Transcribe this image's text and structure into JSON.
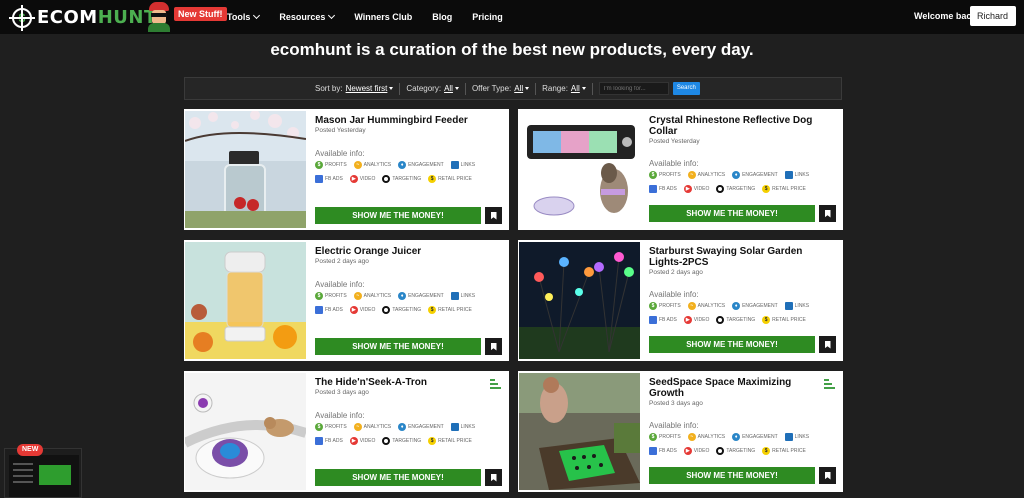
{
  "nav": {
    "logo_part1": "ECOM",
    "logo_part2": "HUNT",
    "new_stuff": "New Stuff!",
    "menu": [
      {
        "label": "Tools",
        "dropdown": true
      },
      {
        "label": "Resources",
        "dropdown": true
      },
      {
        "label": "Winners Club",
        "dropdown": false
      },
      {
        "label": "Blog",
        "dropdown": false
      },
      {
        "label": "Pricing",
        "dropdown": false
      }
    ],
    "welcome": "Welcome back",
    "user": "Richard"
  },
  "headline": "ecomhunt is a curation of the best new products, every day.",
  "filters": {
    "sort_label": "Sort by:",
    "sort_value": "Newest first",
    "category_label": "Category:",
    "category_value": "All",
    "offer_label": "Offer Type:",
    "offer_value": "All",
    "range_label": "Range:",
    "range_value": "All",
    "search_placeholder": "I'm looking for...",
    "search_button": "Search"
  },
  "info_labels": {
    "available": "Available info:",
    "profits": "PROFITS",
    "analytics": "ANALYTICS",
    "engagement": "ENGAGEMENT",
    "links": "LINKS",
    "fb_ads": "FB ADS",
    "video": "VIDEO",
    "targeting": "TARGETING",
    "retail_price": "RETAIL PRICE"
  },
  "cta": "SHOW ME THE MONEY!",
  "products": [
    {
      "title": "Mason Jar Hummingbird Feeder",
      "posted": "Posted Yesterday"
    },
    {
      "title": "Crystal Rhinestone Reflective Dog Collar",
      "posted": "Posted Yesterday"
    },
    {
      "title": "Electric Orange Juicer",
      "posted": "Posted 2 days ago"
    },
    {
      "title": "Starburst Swaying Solar Garden Lights-2PCS",
      "posted": "Posted 2 days ago"
    },
    {
      "title": "The Hide'n'Seek-A-Tron",
      "posted": "Posted 3 days ago"
    },
    {
      "title": "SeedSpace Space Maximizing Growth",
      "posted": "Posted 3 days ago"
    }
  ],
  "promo_badge": "NEW",
  "colors": {
    "brand_green": "#4caf50",
    "cta_green": "#2e8b22",
    "new_red": "#e53935",
    "search_blue": "#1e88e5"
  }
}
